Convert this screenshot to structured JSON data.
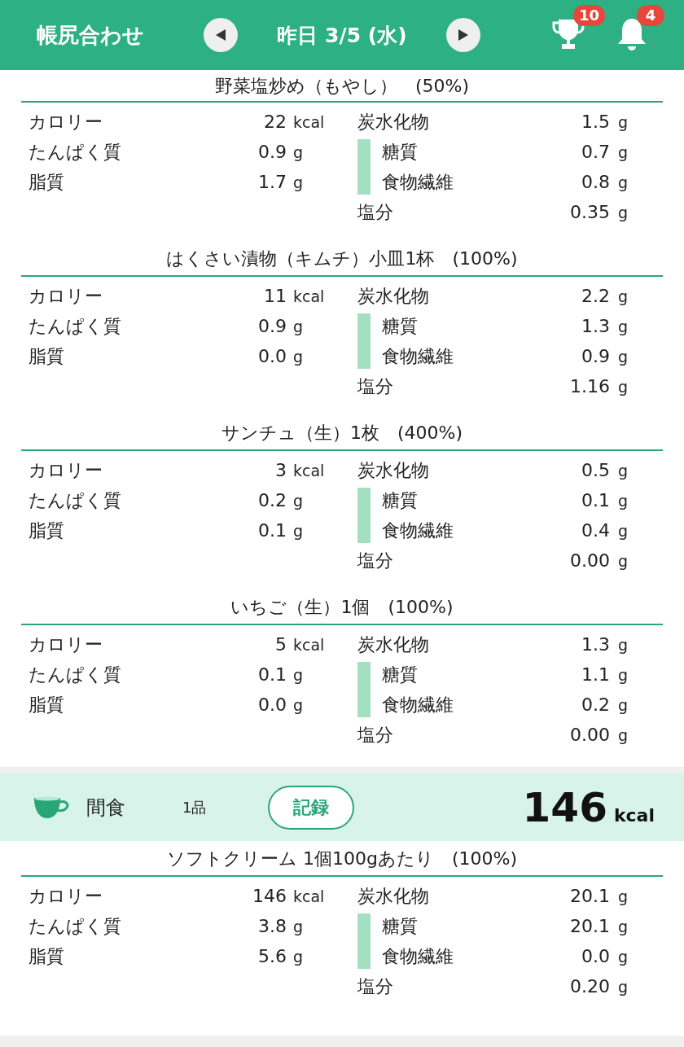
{
  "header": {
    "title": "帳尻合わせ",
    "date": "昨日 3/5 (水)",
    "badges": [
      {
        "kind": "trophy",
        "count": "10"
      },
      {
        "kind": "bell",
        "count": "4"
      }
    ]
  },
  "sections": [
    {
      "kind": "food",
      "title": "野菜塩炒め（もやし）　(50%)",
      "left": [
        {
          "label": "カロリー",
          "value": "22",
          "unit": "kcal"
        },
        {
          "label": "たんぱく質",
          "value": "0.9",
          "unit": "g"
        },
        {
          "label": "脂質",
          "value": "1.7",
          "unit": "g"
        }
      ],
      "right": [
        {
          "label": "炭水化物",
          "value": "1.5",
          "unit": "g",
          "sub": false
        },
        {
          "label": "糖質",
          "value": "0.7",
          "unit": "g",
          "sub": true
        },
        {
          "label": "食物繊維",
          "value": "0.8",
          "unit": "g",
          "sub": true
        },
        {
          "label": "塩分",
          "value": "0.35",
          "unit": "g",
          "sub": false
        }
      ]
    },
    {
      "kind": "food",
      "title": "はくさい漬物（キムチ）小皿1杯　(100%)",
      "left": [
        {
          "label": "カロリー",
          "value": "11",
          "unit": "kcal"
        },
        {
          "label": "たんぱく質",
          "value": "0.9",
          "unit": "g"
        },
        {
          "label": "脂質",
          "value": "0.0",
          "unit": "g"
        }
      ],
      "right": [
        {
          "label": "炭水化物",
          "value": "2.2",
          "unit": "g",
          "sub": false
        },
        {
          "label": "糖質",
          "value": "1.3",
          "unit": "g",
          "sub": true
        },
        {
          "label": "食物繊維",
          "value": "0.9",
          "unit": "g",
          "sub": true
        },
        {
          "label": "塩分",
          "value": "1.16",
          "unit": "g",
          "sub": false
        }
      ]
    },
    {
      "kind": "food",
      "title": "サンチュ（生）1枚　(400%)",
      "left": [
        {
          "label": "カロリー",
          "value": "3",
          "unit": "kcal"
        },
        {
          "label": "たんぱく質",
          "value": "0.2",
          "unit": "g"
        },
        {
          "label": "脂質",
          "value": "0.1",
          "unit": "g"
        }
      ],
      "right": [
        {
          "label": "炭水化物",
          "value": "0.5",
          "unit": "g",
          "sub": false
        },
        {
          "label": "糖質",
          "value": "0.1",
          "unit": "g",
          "sub": true
        },
        {
          "label": "食物繊維",
          "value": "0.4",
          "unit": "g",
          "sub": true
        },
        {
          "label": "塩分",
          "value": "0.00",
          "unit": "g",
          "sub": false
        }
      ]
    },
    {
      "kind": "food",
      "title": "いちご（生）1個　(100%)",
      "left": [
        {
          "label": "カロリー",
          "value": "5",
          "unit": "kcal"
        },
        {
          "label": "たんぱく質",
          "value": "0.1",
          "unit": "g"
        },
        {
          "label": "脂質",
          "value": "0.0",
          "unit": "g"
        }
      ],
      "right": [
        {
          "label": "炭水化物",
          "value": "1.3",
          "unit": "g",
          "sub": false
        },
        {
          "label": "糖質",
          "value": "1.1",
          "unit": "g",
          "sub": true
        },
        {
          "label": "食物繊維",
          "value": "0.2",
          "unit": "g",
          "sub": true
        },
        {
          "label": "塩分",
          "value": "0.00",
          "unit": "g",
          "sub": false
        }
      ]
    },
    {
      "kind": "meal",
      "name": "間食",
      "count": "1品",
      "button": "記録",
      "calories": "146",
      "unit": "kcal"
    },
    {
      "kind": "food",
      "title": "ソフトクリーム 1個100gあたり　(100%)",
      "left": [
        {
          "label": "カロリー",
          "value": "146",
          "unit": "kcal"
        },
        {
          "label": "たんぱく質",
          "value": "3.8",
          "unit": "g"
        },
        {
          "label": "脂質",
          "value": "5.6",
          "unit": "g"
        }
      ],
      "right": [
        {
          "label": "炭水化物",
          "value": "20.1",
          "unit": "g",
          "sub": false
        },
        {
          "label": "糖質",
          "value": "20.1",
          "unit": "g",
          "sub": true
        },
        {
          "label": "食物繊維",
          "value": "0.0",
          "unit": "g",
          "sub": true
        },
        {
          "label": "塩分",
          "value": "0.20",
          "unit": "g",
          "sub": false
        }
      ]
    }
  ]
}
